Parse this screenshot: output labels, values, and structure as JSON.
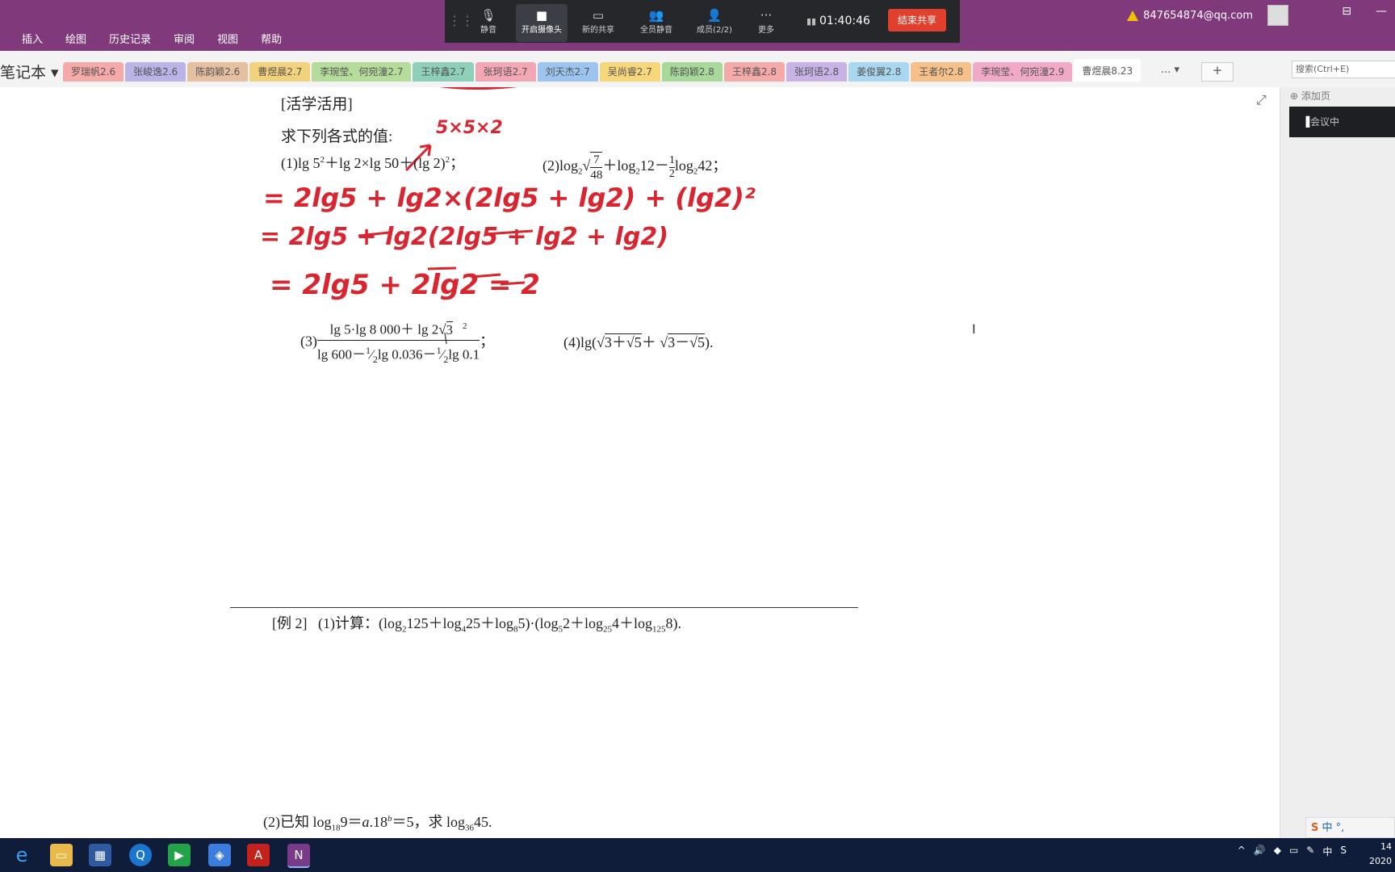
{
  "menu": [
    "插入",
    "绘图",
    "历史记录",
    "审阅",
    "视图",
    "帮助"
  ],
  "account": {
    "email": "847654874@qq.com"
  },
  "meeting": {
    "buttons": [
      "静音",
      "开启摄像头",
      "新的共享",
      "全员静音",
      "成员(2/2)",
      "更多"
    ],
    "timer": "01:40:46",
    "end_share": "结束共享",
    "status": "会议中"
  },
  "notebook": {
    "title": "笔记本"
  },
  "tabs": [
    {
      "label": "罗瑞帆2.6",
      "color": "#f5a9a8"
    },
    {
      "label": "张峻逸2.6",
      "color": "#b9b3e6"
    },
    {
      "label": "陈韵颖2.6",
      "color": "#e4bfa0"
    },
    {
      "label": "曹煜晨2.7",
      "color": "#f3d27d"
    },
    {
      "label": "李琬莹、何宛潼2.7",
      "color": "#b6dc9b"
    },
    {
      "label": "王梓鑫2.7",
      "color": "#8fd0ba"
    },
    {
      "label": "张珂语2.7",
      "color": "#f3a6b3"
    },
    {
      "label": "刘天杰2.7",
      "color": "#9cc4ef"
    },
    {
      "label": "吴尚睿2.7",
      "color": "#f7d77c"
    },
    {
      "label": "陈韵颖2.8",
      "color": "#a8d99a"
    },
    {
      "label": "王梓鑫2.8",
      "color": "#f5a9a8"
    },
    {
      "label": "张珂语2.8",
      "color": "#c8b3e6"
    },
    {
      "label": "姜俊翼2.8",
      "color": "#a9d7f0"
    },
    {
      "label": "王者尔2.8",
      "color": "#f6c08a"
    },
    {
      "label": "李琬莹、何宛潼2.9",
      "color": "#f2a9c8"
    },
    {
      "label": "曹煜晨8.23",
      "color": "#ffffff"
    }
  ],
  "tabs_more": "...",
  "search": {
    "placeholder": "搜索(Ctrl+E)"
  },
  "side": {
    "add_page": "添加页"
  },
  "content": {
    "section_title": "[活学活用]",
    "prompt": "求下列各式的值:",
    "p1": "(1)lg 5²+lg 2×lg 50+(lg 2)²;",
    "p2": "(2)log₂√(7/48)+log₂12−½log₂42;",
    "p3": "(3)(lg 5·lg 8 000+ lg 2√3 ²)/(lg 600−½lg 0.036−½lg 0.1);",
    "p4": "(4)lg(√(3+√5)+ √(3−√5)).",
    "ex2": "[例 2]  (1)计算:(log₂125+log₄25+log₈5)·(log₅2+log₂₅4+log₁₂₅8).",
    "ex2b": "(2)已知 log₁₈9=a.18ᵇ=5,求 log₃₆45."
  },
  "ink": {
    "note": "5×5×2",
    "l1": "= 2lg5 + lg2×(2lg5 + lg2) + (lg2)²",
    "l2": "= 2lg5 + lg2(2lg5 + lg2 + lg2)",
    "l3": "= 2lg5 + 2lg2 = 2"
  },
  "ime": "中 °,",
  "clock": {
    "time": "14",
    "date": "2020"
  }
}
